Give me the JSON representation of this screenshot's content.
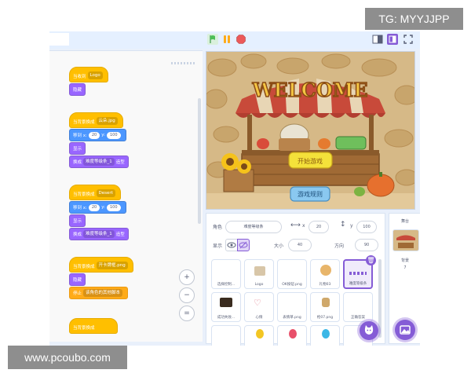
{
  "watermarks": {
    "top": "TG: MYYJJPP",
    "bottom": "www.pcoubo.com"
  },
  "colors": {
    "event": "#ffbf00",
    "looks": "#9966ff",
    "motion": "#4c97ff",
    "control": "#ffab19",
    "accent": "#855cd6",
    "green_flag": "#4cbf56",
    "stop": "#ec5959"
  },
  "scripts": [
    {
      "hat": {
        "label": "当收到",
        "dropdown": "Logo"
      },
      "blocks": [
        {
          "label": "隐藏"
        }
      ]
    },
    {
      "hat": {
        "label": "当背景换成",
        "dropdown": "云朵.jpg"
      },
      "blocks": [
        {
          "label": "移到 x:",
          "x": "20",
          "ylabel": "y:",
          "y": "100"
        },
        {
          "label": "显示"
        },
        {
          "label": "换成",
          "dropdown": "难度等级条_1",
          "suffix": "造型"
        }
      ]
    },
    {
      "hat": {
        "label": "当背景换成",
        "dropdown": "Desert"
      },
      "blocks": [
        {
          "label": "移到 x:",
          "x": "20",
          "ylabel": "y:",
          "y": "100"
        },
        {
          "label": "显示"
        },
        {
          "label": "换成",
          "dropdown": "难度等级条_1",
          "suffix": "造型"
        }
      ]
    },
    {
      "hat": {
        "label": "当背景换成",
        "dropdown": "开卡牌框.png"
      },
      "blocks": [
        {
          "label": "隐藏"
        },
        {
          "label": "停止",
          "dropdown": "该角色的其他脚本"
        }
      ]
    },
    {
      "hat": {
        "label": "当背景换成",
        "dropdown": ""
      },
      "blocks": []
    }
  ],
  "zoom_controls": {
    "zoom_in": "+",
    "zoom_out": "−",
    "reset": "="
  },
  "stage": {
    "sign": "WELCOME",
    "button1": "开始游戏",
    "button2": "游戏规则"
  },
  "sprite_info": {
    "sprite_label": "角色",
    "sprite_name": "难度等级条",
    "x_label": "x",
    "x": "20",
    "y_label": "y",
    "y": "100",
    "show_label": "显示",
    "size_label": "大小",
    "size": "40",
    "direction_label": "方向",
    "direction": "90"
  },
  "sprites": [
    {
      "name": "选择控制..."
    },
    {
      "name": "Logo"
    },
    {
      "name": "OK按钮.png"
    },
    {
      "name": "礼物03"
    },
    {
      "name": "难度等级条",
      "selected": true
    },
    {
      "name": "成功失败..."
    },
    {
      "name": "心情"
    },
    {
      "name": "表情草.png"
    },
    {
      "name": "枪07.png"
    },
    {
      "name": "正确答案"
    },
    {
      "name": ""
    },
    {
      "name": ""
    },
    {
      "name": ""
    },
    {
      "name": ""
    },
    {
      "name": ""
    }
  ],
  "stage_panel": {
    "title": "舞台",
    "backdrops_label": "背景",
    "backdrops_count": "7"
  }
}
